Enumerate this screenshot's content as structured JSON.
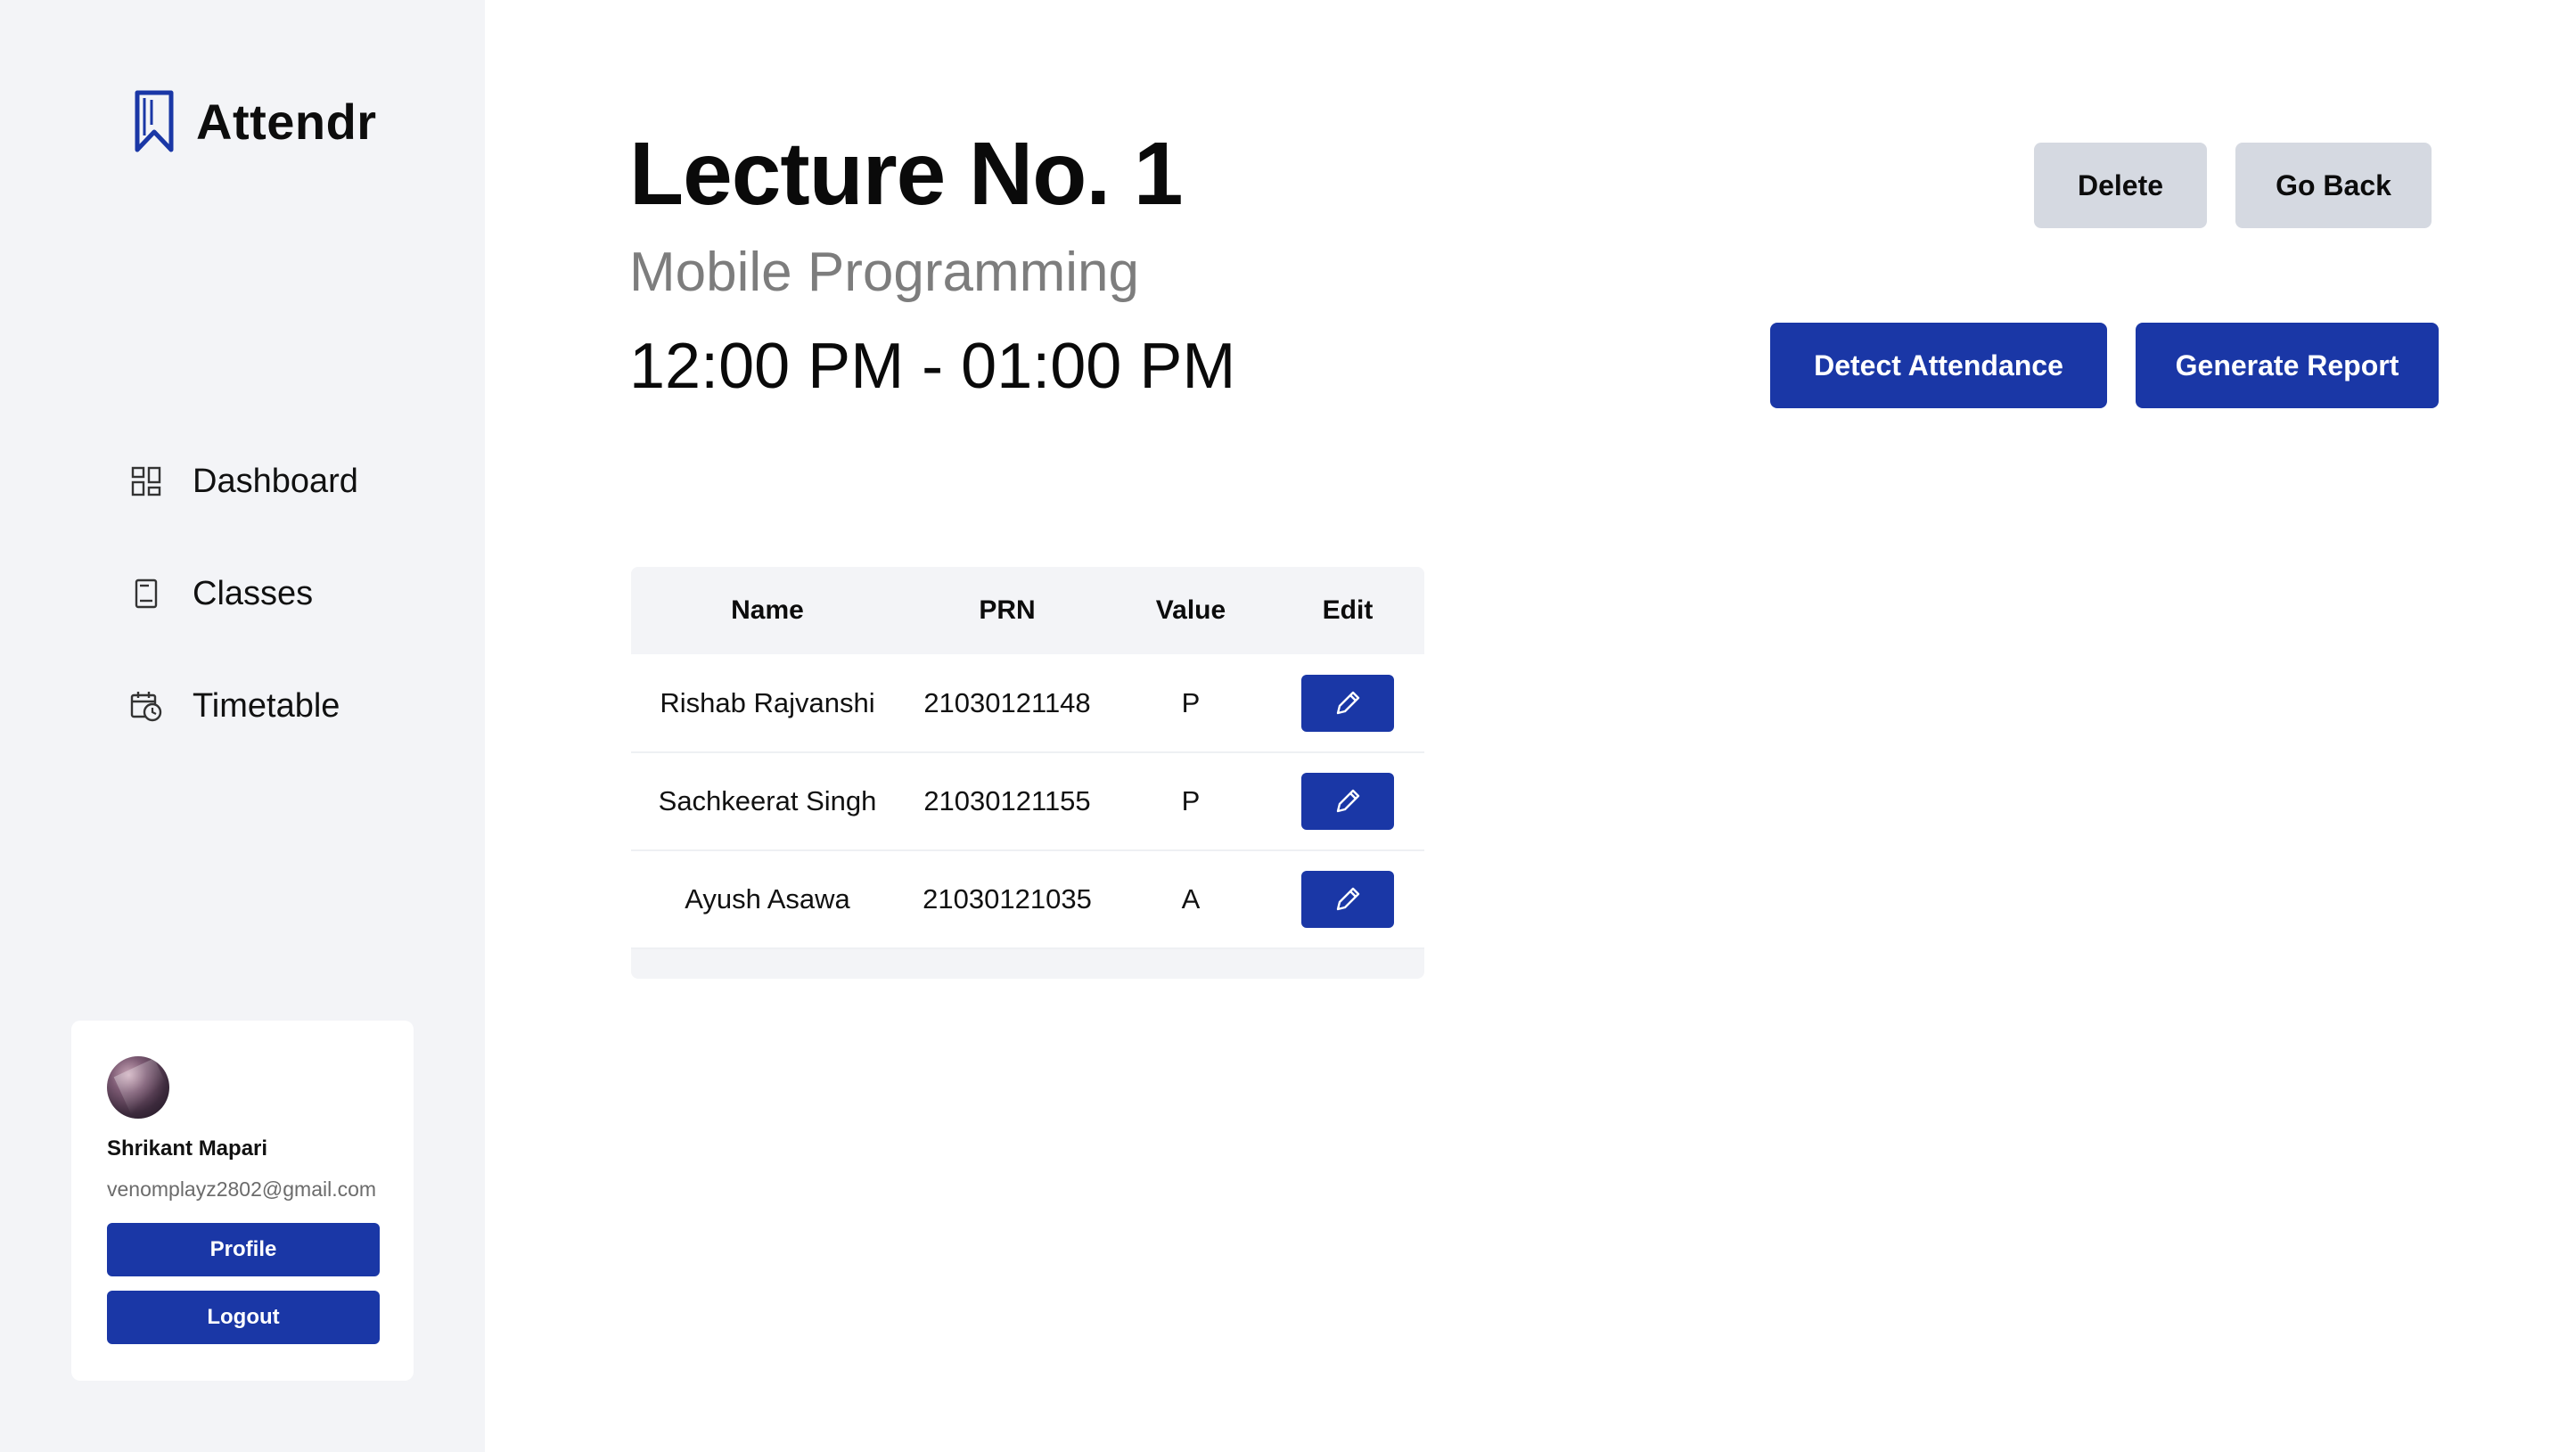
{
  "brand": {
    "name": "Attendr",
    "logo_icon": "bookmark-logo-icon",
    "accent": "#1a37a6"
  },
  "sidebar": {
    "items": [
      {
        "label": "Dashboard",
        "icon": "grid-icon"
      },
      {
        "label": "Classes",
        "icon": "book-icon"
      },
      {
        "label": "Timetable",
        "icon": "calendar-clock-icon"
      }
    ]
  },
  "user": {
    "name": "Shrikant Mapari",
    "email": "venomplayz2802@gmail.com",
    "profile_label": "Profile",
    "logout_label": "Logout"
  },
  "lecture": {
    "title": "Lecture No. 1",
    "subject": "Mobile Programming",
    "time": "12:00 PM - 01:00 PM"
  },
  "actions": {
    "delete_label": "Delete",
    "go_back_label": "Go Back",
    "detect_label": "Detect Attendance",
    "report_label": "Generate Report"
  },
  "table": {
    "headers": [
      "Name",
      "PRN",
      "Value",
      "Edit"
    ],
    "rows": [
      {
        "name": "Rishab Rajvanshi",
        "prn": "21030121148",
        "value": "P"
      },
      {
        "name": "Sachkeerat Singh",
        "prn": "21030121155",
        "value": "P"
      },
      {
        "name": "Ayush Asawa",
        "prn": "21030121035",
        "value": "A"
      }
    ],
    "edit_icon": "pencil-icon"
  },
  "colors": {
    "primary": "#1a37a6",
    "secondary_button": "#d5d9e1",
    "sidebar_bg": "#f3f4f7"
  }
}
